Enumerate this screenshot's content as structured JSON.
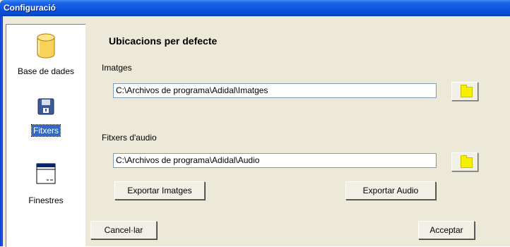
{
  "window": {
    "title": "Configuració"
  },
  "sidebar": {
    "items": [
      {
        "label": "Base de dades",
        "icon": "database-icon"
      },
      {
        "label": "Fitxers",
        "icon": "floppy-disk-icon",
        "selected": true
      },
      {
        "label": "Finestres",
        "icon": "window-icon"
      }
    ]
  },
  "main": {
    "heading": "Ubicacions per defecte",
    "images": {
      "label": "Imatges",
      "path": "C:\\Archivos de programa\\Adidal\\Imatges"
    },
    "audio": {
      "label": "Fitxers d'audio",
      "path": "C:\\Archivos de programa\\Adidal\\Audio"
    },
    "export_images_label": "Exportar Imatges",
    "export_audio_label": "Exportar Audio",
    "cancel_label": "Cancel·lar",
    "accept_label": "Acceptar"
  },
  "colors": {
    "titlebar": "#0d55e0",
    "selection": "#316ac5",
    "folder": "#f6f000",
    "dialog": "#ece9d8"
  }
}
